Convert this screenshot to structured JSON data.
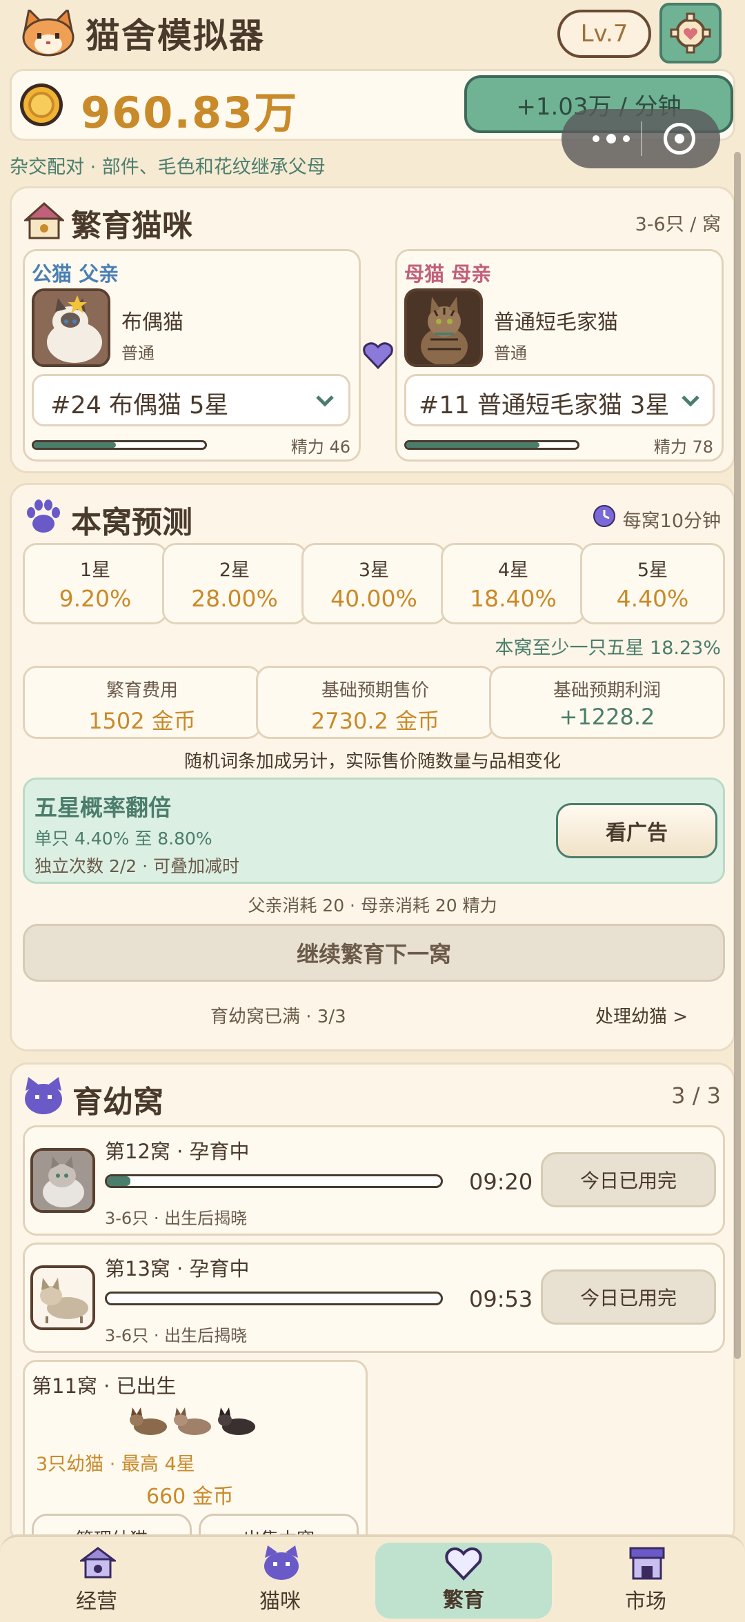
{
  "app": {
    "title": "猫舍模拟器",
    "level": "Lv.7"
  },
  "colors": {
    "accent_green": "#4b7d6c",
    "gold": "#c98a2a",
    "male_blue": "#4a7fb5",
    "female_pink": "#c0607a",
    "promo_bg": "#dcefe3"
  },
  "wallet": {
    "coins": "960.83万",
    "rate": "+1.03万 / 分钟"
  },
  "subtitle": "杂交配对 · 部件、毛色和花纹继承父母",
  "breeding": {
    "title": "繁育猫咪",
    "litter_range": "3-6只 / 窝",
    "father": {
      "role": "公猫 父亲",
      "breed": "布偶猫",
      "rarity": "普通",
      "selector": "#24 布偶猫 5星",
      "energy": "精力 46",
      "energy_level": 0.48
    },
    "mother": {
      "role": "母猫 母亲",
      "breed": "普通短毛家猫",
      "rarity": "普通",
      "selector": "#11 普通短毛家猫 3星",
      "energy": "精力 78",
      "energy_level": 0.78
    }
  },
  "prediction": {
    "title": "本窝预测",
    "interval": "每窝10分钟",
    "stars": [
      {
        "label": "1星",
        "value": "9.20%"
      },
      {
        "label": "2星",
        "value": "28.00%"
      },
      {
        "label": "3星",
        "value": "40.00%"
      },
      {
        "label": "4星",
        "value": "18.40%"
      },
      {
        "label": "5星",
        "value": "4.40%"
      }
    ],
    "five_star_note": "本窝至少一只五星 18.23%",
    "economics": [
      {
        "label": "繁育费用",
        "value": "1502 金币"
      },
      {
        "label": "基础预期售价",
        "value": "2730.2 金币"
      },
      {
        "label": "基础预期利润",
        "value": "+1228.2"
      }
    ],
    "random_note": "随机词条加成另计，实际售价随数量与品相变化",
    "promo": {
      "title": "五星概率翻倍",
      "line1": "单只 4.40% 至 8.80%",
      "line2": "独立次数 2/2 · 可叠加减时",
      "button": "看广告"
    },
    "cost_note": "父亲消耗 20 · 母亲消耗 20 精力",
    "continue_button": "继续繁育下一窝",
    "nursery_full": "育幼窝已满 · 3/3",
    "handle_link": "处理幼猫 >"
  },
  "nursery": {
    "title": "育幼窝",
    "count": "3 / 3",
    "litters": [
      {
        "title": "第12窝 · 孕育中",
        "meta": "3-6只 · 出生后揭晓",
        "time": "09:20",
        "button": "今日已用完",
        "progress": 0.07
      },
      {
        "title": "第13窝 · 孕育中",
        "meta": "3-6只 · 出生后揭晓",
        "time": "09:53",
        "button": "今日已用完",
        "progress": 0.0
      }
    ],
    "born": {
      "title": "第11窝 · 已出生",
      "summary": "3只幼猫 · 最高 4星",
      "value": "660 金币",
      "btn1": "管理幼猫",
      "btn2": "出售本窝"
    }
  },
  "tabs": [
    {
      "label": "经营",
      "icon": "shop-icon"
    },
    {
      "label": "猫咪",
      "icon": "cat-face-icon"
    },
    {
      "label": "繁育",
      "icon": "heart-icon",
      "active": true
    },
    {
      "label": "市场",
      "icon": "market-icon"
    }
  ]
}
